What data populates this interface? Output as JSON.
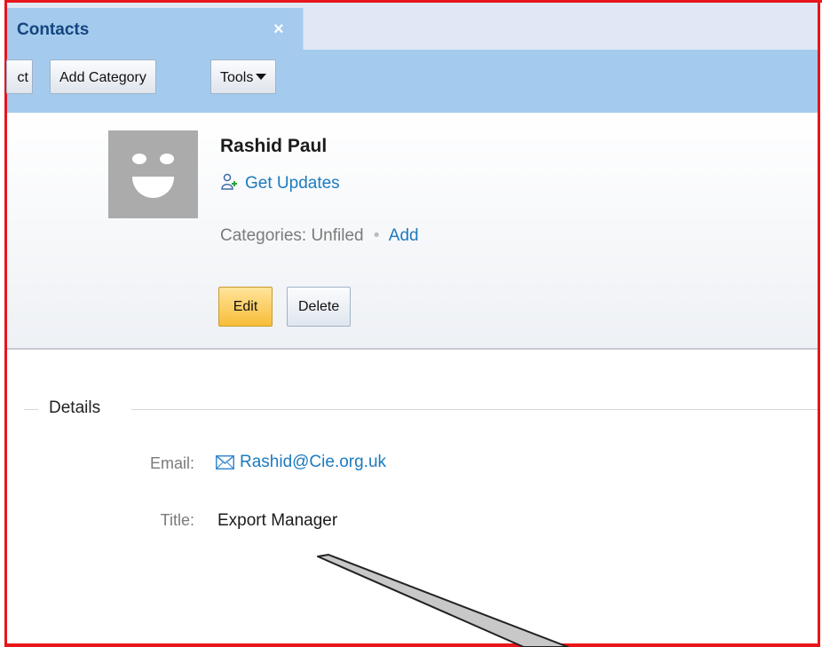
{
  "tab": {
    "label": "Contacts",
    "close_symbol": "×"
  },
  "toolbar": {
    "partial_label": "ct",
    "add_category_label": "Add Category",
    "tools_label": "Tools"
  },
  "contact": {
    "name": "Rashid Paul",
    "get_updates_label": "Get Updates",
    "categories_label": "Categories:",
    "categories_value": "Unfiled",
    "categories_separator": "•",
    "categories_add_label": "Add",
    "edit_label": "Edit",
    "delete_label": "Delete"
  },
  "details": {
    "section_title": "Details",
    "email_label": "Email:",
    "email_value": "Rashid@Cie.org.uk",
    "title_label": "Title:",
    "title_value": "Export Manager"
  },
  "icons": {
    "add_person": "add-person-icon",
    "envelope": "envelope-icon",
    "avatar": "default-avatar-smiley"
  },
  "colors": {
    "frame": "#e8151b",
    "toolbar_blue": "#a4cbee",
    "link_blue": "#1c7bbf",
    "edit_button": "#f7bd38",
    "avatar_gray": "#ababab"
  }
}
